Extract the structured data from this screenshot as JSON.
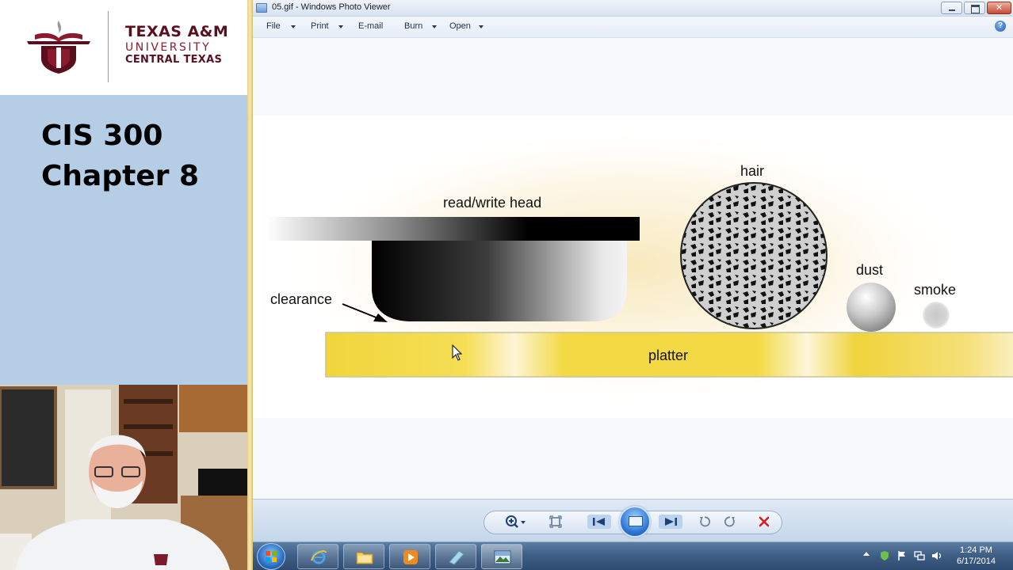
{
  "slide": {
    "logo": {
      "line1": "TEXAS A&M",
      "line2": "UNIVERSITY",
      "line3": "CENTRAL TEXAS"
    },
    "title_line1": "CIS 300",
    "title_line2": "Chapter 8"
  },
  "viewer": {
    "window_title": "05.gif - Windows Photo Viewer",
    "menu": [
      {
        "label": "File",
        "has_dropdown": true
      },
      {
        "label": "Print",
        "has_dropdown": true
      },
      {
        "label": "E-mail",
        "has_dropdown": false
      },
      {
        "label": "Burn",
        "has_dropdown": true
      },
      {
        "label": "Open",
        "has_dropdown": true
      }
    ],
    "help_label": "?",
    "diagram": {
      "head_label": "read/write head",
      "clearance_label": "clearance",
      "hair_label": "hair",
      "dust_label": "dust",
      "smoke_label": "smoke",
      "platter_label": "platter"
    },
    "controls": {
      "zoom_icon": "magnifier-icon",
      "actual_size_icon": "actual-size-icon",
      "previous_icon": "previous-icon",
      "slideshow_icon": "slideshow-icon",
      "next_icon": "next-icon",
      "rotate_left_icon": "rotate-counterclockwise-icon",
      "rotate_right_icon": "rotate-clockwise-icon",
      "delete_icon": "delete-icon"
    }
  },
  "taskbar": {
    "time": "1:24 PM",
    "date": "6/17/2014"
  },
  "colors": {
    "slide_background": "#b6cde6",
    "platter_yellow": "#f2da45",
    "aggie_maroon": "#5a0f1e"
  }
}
